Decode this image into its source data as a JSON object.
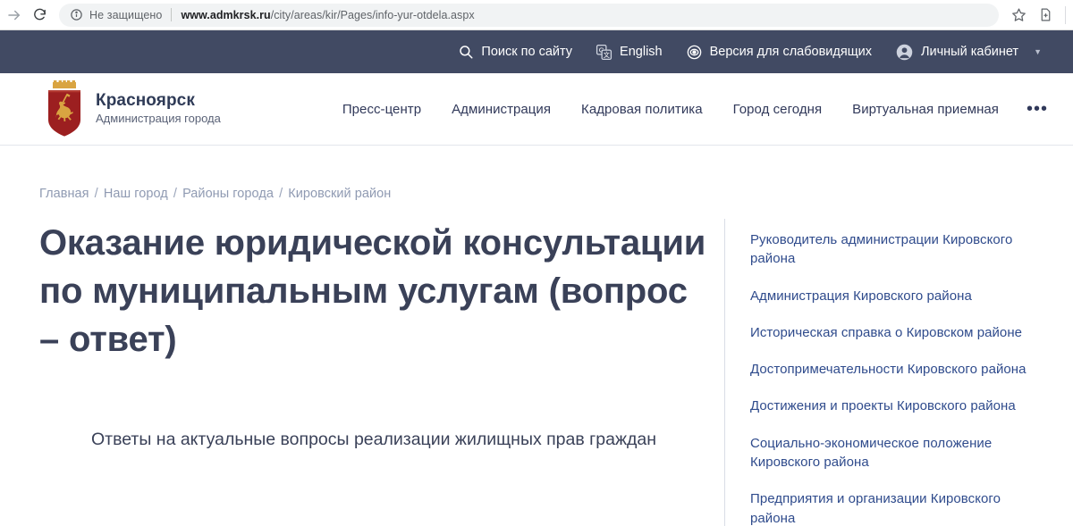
{
  "browser": {
    "security_label": "Не защищено",
    "url_host": "www.admkrsk.ru",
    "url_path": "/city/areas/kir/Pages/info-yur-otdela.aspx",
    "forward_icon": "arrow-forward-icon",
    "reload_icon": "reload-icon",
    "info_icon": "info-circle-icon",
    "bookmark_icon": "star-icon",
    "new_doc_icon": "document-plus-icon"
  },
  "utility_bar": {
    "background": "#414a63",
    "items": [
      {
        "label": "Поиск по сайту",
        "icon": "search-icon"
      },
      {
        "label": "English",
        "icon": "translate-icon"
      },
      {
        "label": "Версия для слабовидящих",
        "icon": "eye-icon"
      },
      {
        "label": "Личный кабинет",
        "icon": "user-circle-icon",
        "caret": "▼"
      }
    ]
  },
  "header": {
    "brand_title": "Красноярск",
    "brand_subtitle": "Администрация города",
    "crest_icon": "krasnoyarsk-coat-of-arms",
    "nav": [
      {
        "label": "Пресс-центр"
      },
      {
        "label": "Администрация"
      },
      {
        "label": "Кадровая политика"
      },
      {
        "label": "Город сегодня"
      },
      {
        "label": "Виртуальная приемная"
      }
    ],
    "more_label": "•••"
  },
  "breadcrumb": {
    "items": [
      "Главная",
      "Наш город",
      "Районы города",
      "Кировский район"
    ],
    "separator": "/"
  },
  "main": {
    "title": "Оказание юридической консультации по муниципальным услугам (вопрос – ответ)",
    "lede": "Ответы на актуальные вопросы реализации жилищных прав граждан"
  },
  "rail": {
    "links": [
      "Руководитель администрации Кировского района",
      "Администрация Кировского района",
      "Историческая справка о Кировском районе",
      "Достопримечательности Кировского района",
      "Достижения и проекты Кировского района",
      "Социально-экономическое положение Кировского района",
      "Предприятия и организации Кировского района"
    ]
  },
  "colors": {
    "navbar": "#414a63",
    "heading": "#3a4158",
    "link": "#2f4b8c",
    "breadcrumb": "#8f9ab2",
    "crest_red": "#9c1f20",
    "crest_gold": "#d9a441"
  }
}
